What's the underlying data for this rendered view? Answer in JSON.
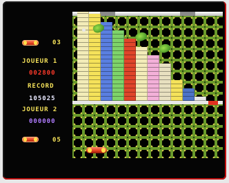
{
  "hud": {
    "lives_count": "03",
    "player1_label": "JOUEUR 1",
    "player1_score": "002800",
    "record_label": "RECORD",
    "record_score": "105025",
    "player2_label": "JOUEUR 2",
    "player2_score": "000000",
    "level_count": "05"
  },
  "colors": {
    "hud_yellow": "#f5e25a",
    "score_red": "#ff3a2a",
    "record_white": "#e8e8ff",
    "player2_score_purple": "#b07cff"
  },
  "bricks": {
    "columns": [
      {
        "color": "#f3ecb8",
        "rows": 23
      },
      {
        "color": "#f5e25a",
        "rows": 21
      },
      {
        "color": "#5a7fe0",
        "rows": 19
      },
      {
        "color": "#7ed36a",
        "rows": 17
      },
      {
        "color": "#e0452a",
        "rows": 15
      },
      {
        "color": "#f3ecb8",
        "rows": 13
      },
      {
        "color": "#f3b0d8",
        "rows": 11
      },
      {
        "color": "#e8e0c0",
        "rows": 9
      },
      {
        "color": "#f5e25a",
        "rows": 5
      },
      {
        "color": "#4e74c8",
        "rows": 3
      },
      {
        "color": "#e8e8e8",
        "rows": 1
      }
    ]
  }
}
